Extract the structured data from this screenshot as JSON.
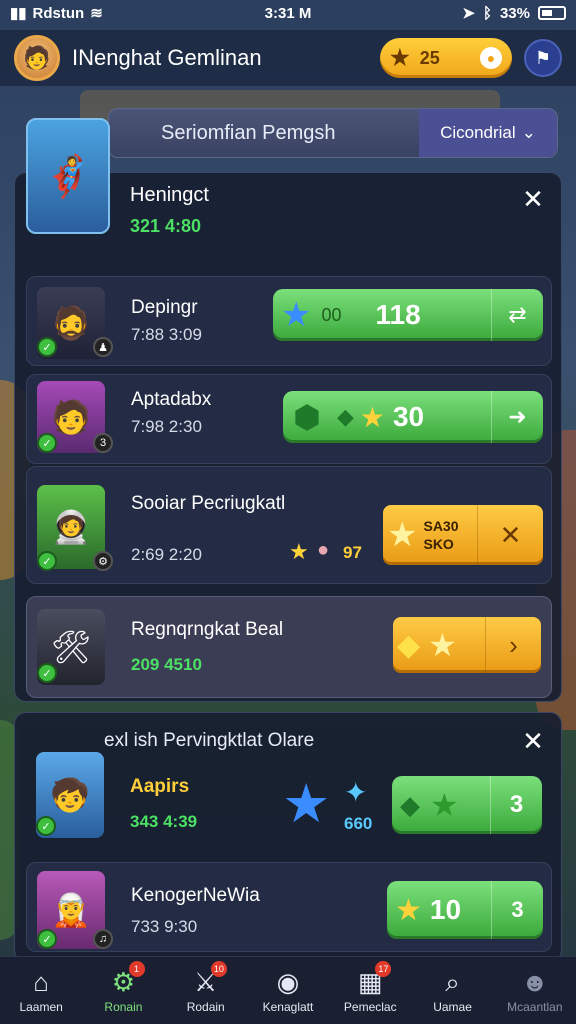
{
  "status": {
    "carrier": "Rdstun",
    "time": "3:31 M",
    "battery": "33%"
  },
  "topbar": {
    "title": "INenghat Gemlinan",
    "coins": "25",
    "avatar_icon": "hero-avatar"
  },
  "filter": {
    "label": "Seriomfian Pemgsh",
    "dropdown": "Cicondrial"
  },
  "panel1": {
    "header": {
      "name": "Heningct",
      "time": "321 4:80"
    },
    "rows": [
      {
        "name": "Depingr",
        "time": "7:88 3:09",
        "value": "118",
        "sub": "00"
      },
      {
        "name": "Aptadabx",
        "time": "7:98 2:30",
        "value": "30"
      },
      {
        "name": "Sooiar Pecriugkatl",
        "time": "2:69 2:20",
        "reward": "97",
        "box_top": "SA30",
        "box_bottom": "SKO"
      },
      {
        "name": "Regnqrngkat Beal",
        "time": "209 4510"
      }
    ]
  },
  "panel2": {
    "header": "exl ish Pervingktlat Olare",
    "rows": [
      {
        "name": "Aapirs",
        "time": "343 4:39",
        "sub": "660",
        "value": "3"
      },
      {
        "name": "KenogerNeWia",
        "time": "733 9:30",
        "value": "10",
        "act": "3"
      }
    ]
  },
  "nav": [
    {
      "label": "Laamen",
      "icon": "home-icon"
    },
    {
      "label": "Ronain",
      "icon": "gear-icon",
      "badge": "1"
    },
    {
      "label": "Rodain",
      "icon": "swords-icon",
      "badge": "10"
    },
    {
      "label": "Kenaglatt",
      "icon": "globe-icon"
    },
    {
      "label": "Pemeclac",
      "icon": "calendar-icon",
      "badge": "17"
    },
    {
      "label": "Uamae",
      "icon": "search-icon"
    },
    {
      "label": "Mcaantlan",
      "icon": "profile-icon"
    }
  ]
}
